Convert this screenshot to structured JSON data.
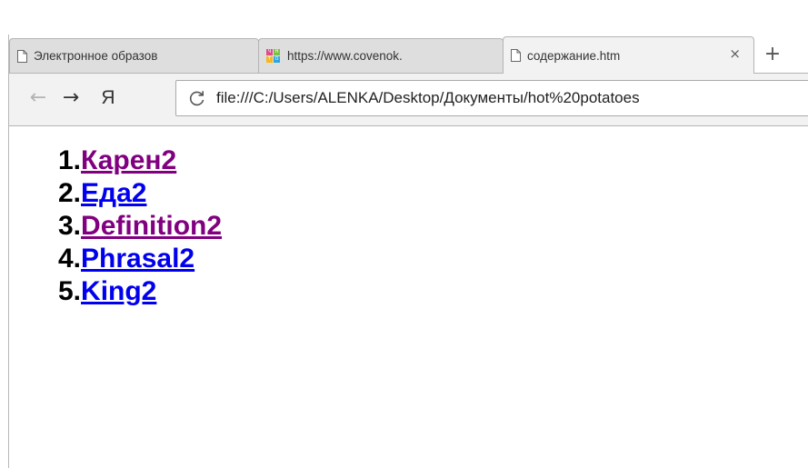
{
  "tabs": [
    {
      "title": "Электронное образов",
      "icon": "document-icon",
      "active": false
    },
    {
      "title": "https://www.covenok.",
      "icon": "site-logo-icon",
      "active": false
    },
    {
      "title": "содержание.htm",
      "icon": "document-icon",
      "active": true,
      "close": "×"
    }
  ],
  "new_tab_label": "+",
  "toolbar": {
    "back": "←",
    "forward": "→",
    "yandex": "Я",
    "url": "file:///C:/Users/ALENKA/Desktop/Документы/hot%20potatoes"
  },
  "toc": [
    {
      "num": "1.",
      "label": "Карен2",
      "visited": true
    },
    {
      "num": "2.",
      "label": "Еда2",
      "visited": false
    },
    {
      "num": "3.",
      "label": "Definition2",
      "visited": true
    },
    {
      "num": "4.",
      "label": "Phrasal2",
      "visited": false
    },
    {
      "num": "5.",
      "label": "King2",
      "visited": false
    }
  ],
  "colors": {
    "link": "#0000ee",
    "visited_link": "#800080",
    "tab_bg": "#dedede",
    "toolbar_bg": "#f2f2f2"
  }
}
